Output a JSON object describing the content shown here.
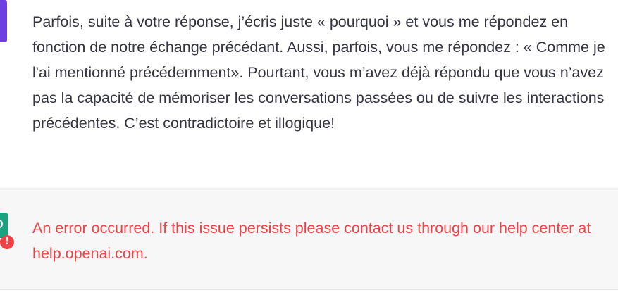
{
  "conversation": {
    "user_message": "Parfois, suite à votre réponse, j’écris juste « pourquoi » et vous me répondez en fonction de notre échange précédant. Aussi, parfois, vous me répondez : « Comme je l'ai mentionné précédemment». Pourtant, vous m’avez déjà répondu que vous n’avez pas la capacité de mémoriser les conversations passées ou de suivre les interactions précédentes. C’est contradictoire et illogique!",
    "error_message": "An error occurred. If this issue persists please contact us through our help center at help.openai.com.",
    "error_badge": "!"
  },
  "icons": {
    "user_avatar": "user-avatar-icon",
    "assistant_avatar": "openai-logo-icon",
    "error_badge": "error-exclamation-icon"
  },
  "colors": {
    "user_avatar": "#6d3ee0",
    "assistant_avatar": "#19a37e",
    "error_text": "#ef4146",
    "body_text": "#343541",
    "assistant_background": "#f7f7f8"
  }
}
